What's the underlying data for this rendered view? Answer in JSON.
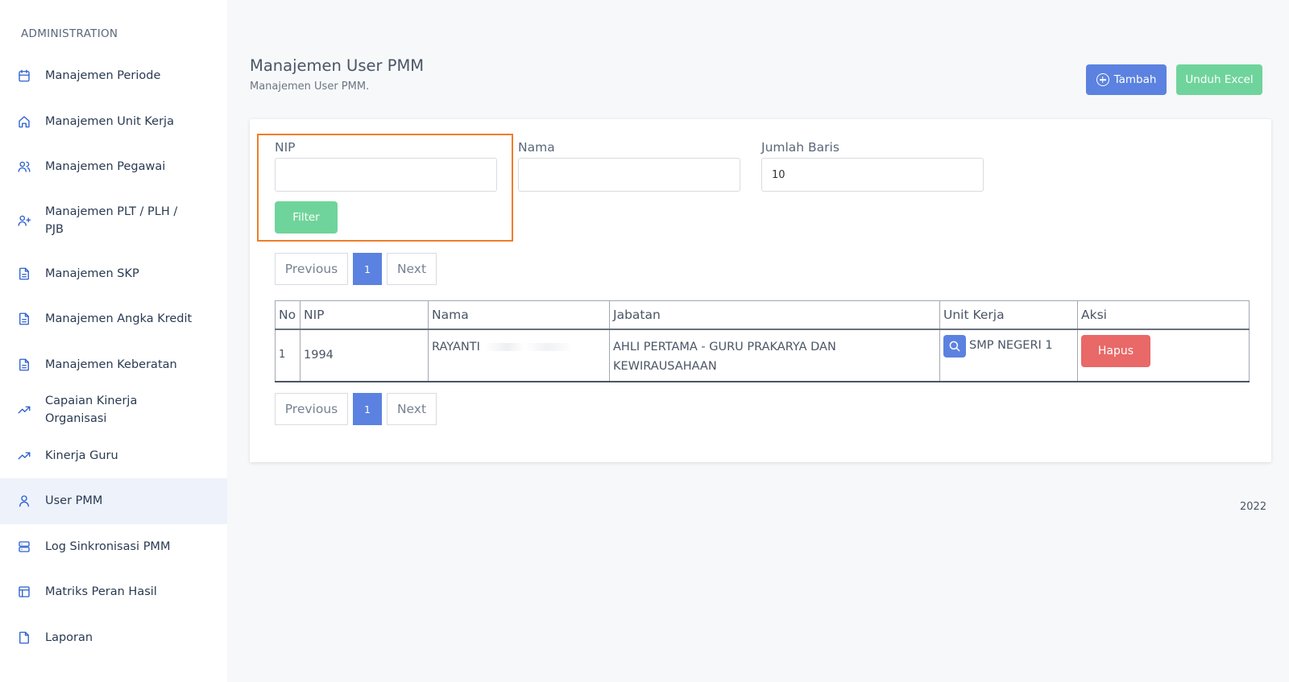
{
  "sidebar": {
    "heading": "ADMINISTRATION",
    "items": [
      {
        "label": "Manajemen Periode",
        "icon": "calendar-icon"
      },
      {
        "label": "Manajemen Unit Kerja",
        "icon": "home-icon"
      },
      {
        "label": "Manajemen Pegawai",
        "icon": "users-icon"
      },
      {
        "label": "Manajemen PLT / PLH / PJB",
        "icon": "user-plus-icon"
      },
      {
        "label": "Manajemen SKP",
        "icon": "document-icon"
      },
      {
        "label": "Manajemen Angka Kredit",
        "icon": "document-icon"
      },
      {
        "label": "Manajemen Keberatan",
        "icon": "document-icon"
      },
      {
        "label": "Capaian Kinerja Organisasi",
        "icon": "trending-up-icon"
      },
      {
        "label": "Kinerja Guru",
        "icon": "trending-up-icon"
      },
      {
        "label": "User PMM",
        "icon": "user-icon",
        "active": true
      },
      {
        "label": "Log Sinkronisasi PMM",
        "icon": "server-icon"
      },
      {
        "label": "Matriks Peran Hasil",
        "icon": "layout-icon"
      },
      {
        "label": "Laporan",
        "icon": "file-icon"
      }
    ]
  },
  "header": {
    "title": "Manajemen User PMM",
    "subtitle": "Manajemen User PMM.",
    "tambah_label": "Tambah",
    "excel_label": "Unduh Excel"
  },
  "filters": {
    "nip_label": "NIP",
    "nip_value": "",
    "nama_label": "Nama",
    "nama_value": "",
    "jumlah_label": "Jumlah Baris",
    "jumlah_value": "10",
    "filter_label": "Filter"
  },
  "pagination": {
    "prev_label": "Previous",
    "current_page": "1",
    "next_label": "Next"
  },
  "table": {
    "headers": [
      "No",
      "NIP",
      "Nama",
      "Jabatan",
      "Unit Kerja",
      "Aksi"
    ],
    "rows": [
      {
        "no": "1",
        "nip": "1994",
        "nama": "RAYANTI",
        "jabatan": "AHLI PERTAMA - GURU PRAKARYA DAN KEWIRAUSAHAAN",
        "unit_kerja": "SMP NEGERI 1",
        "aksi_label": "Hapus"
      }
    ]
  },
  "footer": {
    "text": "2022"
  },
  "colors": {
    "primary": "#5b82e0",
    "success": "#6fd49b",
    "danger": "#e96868",
    "highlight": "#f07d2a",
    "sidebar_icon": "#2b5fce",
    "active_bg": "#edf2fb"
  }
}
